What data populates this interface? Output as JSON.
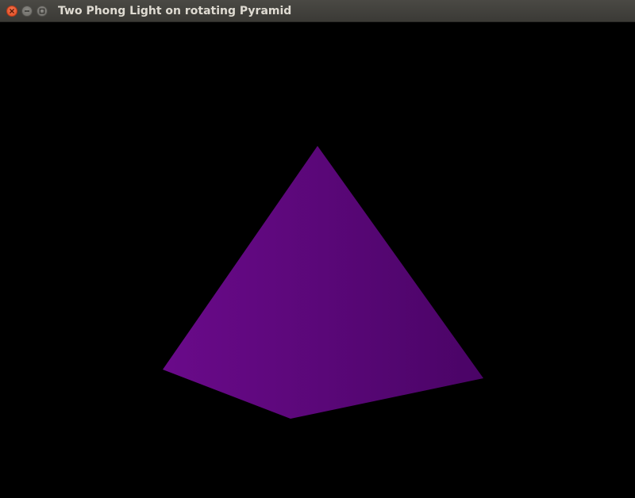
{
  "window": {
    "title": "Two Phong Light on rotating Pyramid"
  },
  "titlebar_buttons": [
    {
      "name": "close",
      "icon": "close-icon"
    },
    {
      "name": "minimize",
      "icon": "minimize-icon"
    },
    {
      "name": "maximize",
      "icon": "maximize-icon"
    }
  ],
  "scene": {
    "background_color": "#000000",
    "pyramid": {
      "light_face_color": "#6a0a8a",
      "dark_face_color": "#4a0466"
    }
  }
}
